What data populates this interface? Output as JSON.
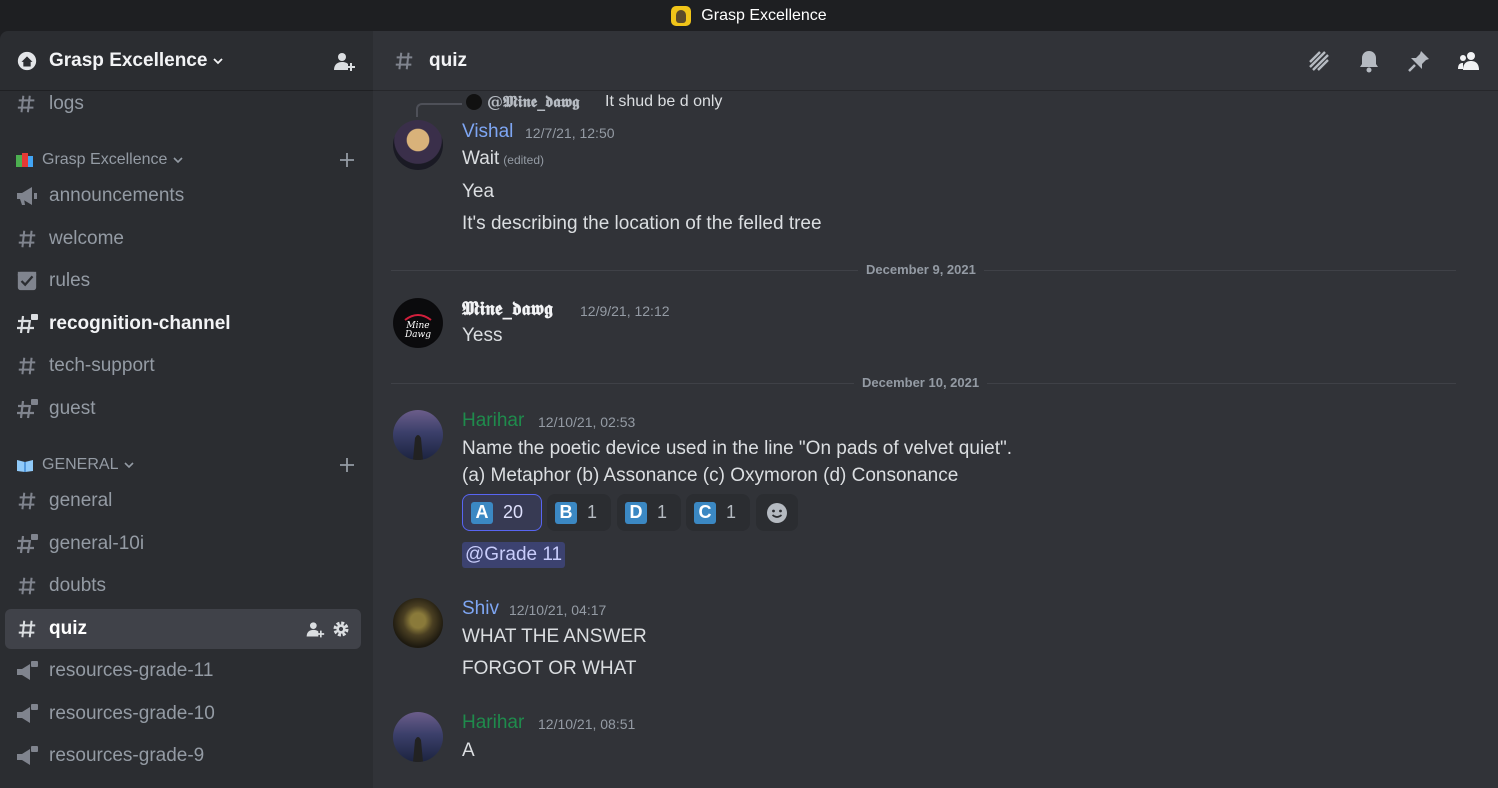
{
  "window": {
    "title": "Grasp Excellence"
  },
  "server": {
    "name": "Grasp Excellence"
  },
  "sidebar": {
    "partial_channel": {
      "label": "logs"
    },
    "categories": [
      {
        "label": "Grasp Excellence"
      },
      {
        "label": "GENERAL"
      }
    ],
    "channels": [
      {
        "label": "announcements"
      },
      {
        "label": "welcome"
      },
      {
        "label": "rules"
      },
      {
        "label": "recognition-channel"
      },
      {
        "label": "tech-support"
      },
      {
        "label": "guest"
      },
      {
        "label": "general"
      },
      {
        "label": "general-10i"
      },
      {
        "label": "doubts"
      },
      {
        "label": "quiz"
      },
      {
        "label": "resources-grade-11"
      },
      {
        "label": "resources-grade-10"
      },
      {
        "label": "resources-grade-9"
      }
    ]
  },
  "header": {
    "channel": "quiz"
  },
  "colors": {
    "harihar": "#1f8b4c",
    "blue_name": "#7ea6f3",
    "accent": "#5865f2"
  },
  "messages": {
    "reply": {
      "name": "@𝕸𝖎𝖓𝖊_𝖉𝖆𝖜𝖌",
      "text": "It shud be d only"
    },
    "m1": {
      "author": "Vishal",
      "time": "12/7/21, 12:50",
      "lines": [
        "Wait",
        "Yea",
        "It's describing the location of the felled tree"
      ],
      "edited": "(edited)"
    },
    "div1": "December 9, 2021",
    "m2": {
      "author": "𝕸𝖎𝖓𝖊_𝖉𝖆𝖜𝖌",
      "time": "12/9/21, 12:12",
      "lines": [
        "Yess"
      ]
    },
    "div2": "December 10, 2021",
    "m3": {
      "author": "Harihar",
      "time": "12/10/21, 02:53",
      "lines": [
        "Name the poetic device used in the line \"On pads of velvet quiet\".",
        "(a) Metaphor (b) Assonance (c) Oxymoron (d) Consonance"
      ],
      "reactions": [
        {
          "letter": "A",
          "count": "20"
        },
        {
          "letter": "B",
          "count": "1"
        },
        {
          "letter": "D",
          "count": "1"
        },
        {
          "letter": "C",
          "count": "1"
        }
      ],
      "mention": "@Grade 11"
    },
    "m4": {
      "author": "Shiv",
      "time": "12/10/21, 04:17",
      "lines": [
        "WHAT THE ANSWER",
        "FORGOT OR WHAT"
      ]
    },
    "m5": {
      "author": "Harihar",
      "time": "12/10/21, 08:51",
      "lines": [
        "A"
      ]
    }
  }
}
